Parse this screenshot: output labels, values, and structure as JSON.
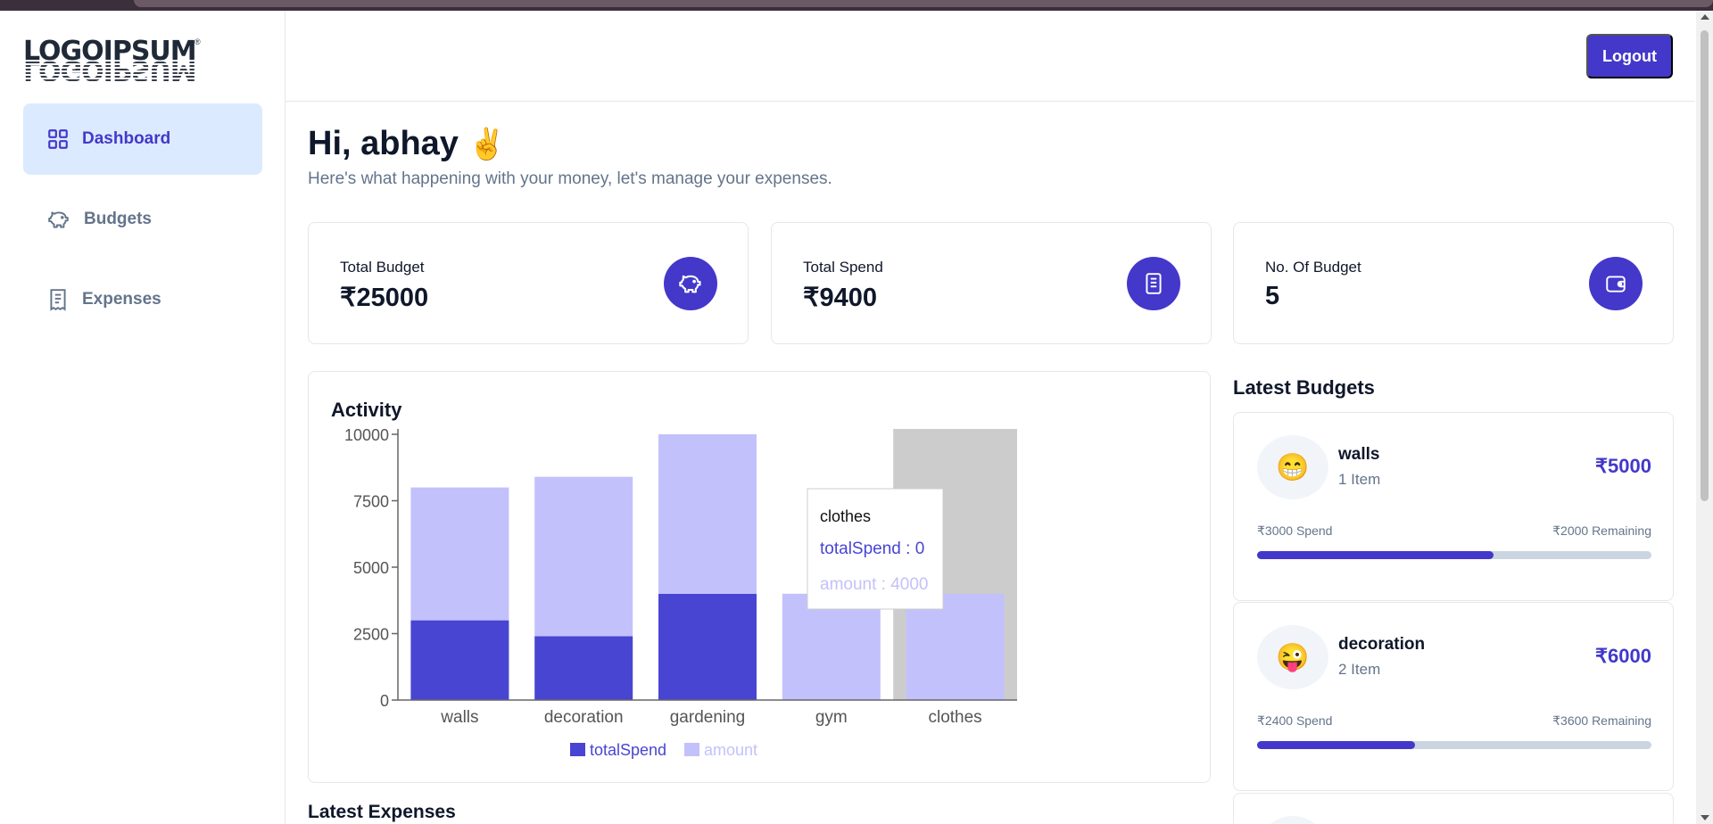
{
  "logo": {
    "text": "LOGOIPSUM",
    "reg": "®"
  },
  "sidebar": {
    "items": [
      {
        "label": "Dashboard",
        "icon": "grid-icon",
        "active": true
      },
      {
        "label": "Budgets",
        "icon": "piggy-bank-icon",
        "active": false
      },
      {
        "label": "Expenses",
        "icon": "receipt-icon",
        "active": false
      }
    ]
  },
  "header": {
    "logout_label": "Logout"
  },
  "greeting": {
    "title": "Hi, abhay",
    "emoji": "✌️",
    "subtitle": "Here's what happening with your money, let's manage your expenses."
  },
  "stats": [
    {
      "label": "Total Budget",
      "value": "₹25000",
      "icon": "piggy-bank-icon"
    },
    {
      "label": "Total Spend",
      "value": "₹9400",
      "icon": "receipt-icon"
    },
    {
      "label": "No. Of Budget",
      "value": "5",
      "icon": "wallet-icon"
    }
  ],
  "activity": {
    "title": "Activity",
    "tooltip": {
      "category": "clothes",
      "total_spend_text": "totalSpend : 0",
      "amount_text": "amount : 4000"
    }
  },
  "chart_data": {
    "type": "bar",
    "stacked": true,
    "categories": [
      "walls",
      "decoration",
      "gardening",
      "gym",
      "clothes"
    ],
    "series": [
      {
        "name": "totalSpend",
        "values": [
          3000,
          2400,
          4000,
          0,
          0
        ],
        "color": "#4845d2"
      },
      {
        "name": "amount",
        "values": [
          5000,
          6000,
          6000,
          4000,
          4000
        ],
        "color": "#c3c1fb"
      }
    ],
    "ylim": [
      0,
      10000
    ],
    "yticks": [
      0,
      2500,
      5000,
      7500,
      10000
    ],
    "legend": "bottom",
    "grid": false,
    "highlighted_category": "clothes",
    "highlight_color": "#cccccc"
  },
  "latest_budgets_title": "Latest Budgets",
  "latest_expenses_title": "Latest Expenses",
  "budgets": [
    {
      "emoji": "😁",
      "name": "walls",
      "items": "1 Item",
      "amount": "₹5000",
      "spend": "₹3000 Spend",
      "remaining": "₹2000 Remaining",
      "progress": 0.6
    },
    {
      "emoji": "😜",
      "name": "decoration",
      "items": "2 Item",
      "amount": "₹6000",
      "spend": "₹2400 Spend",
      "remaining": "₹3600 Remaining",
      "progress": 0.4
    }
  ],
  "colors": {
    "accent": "#4338ca",
    "active_nav_bg": "#dbeafe",
    "muted_text": "#64748b"
  }
}
